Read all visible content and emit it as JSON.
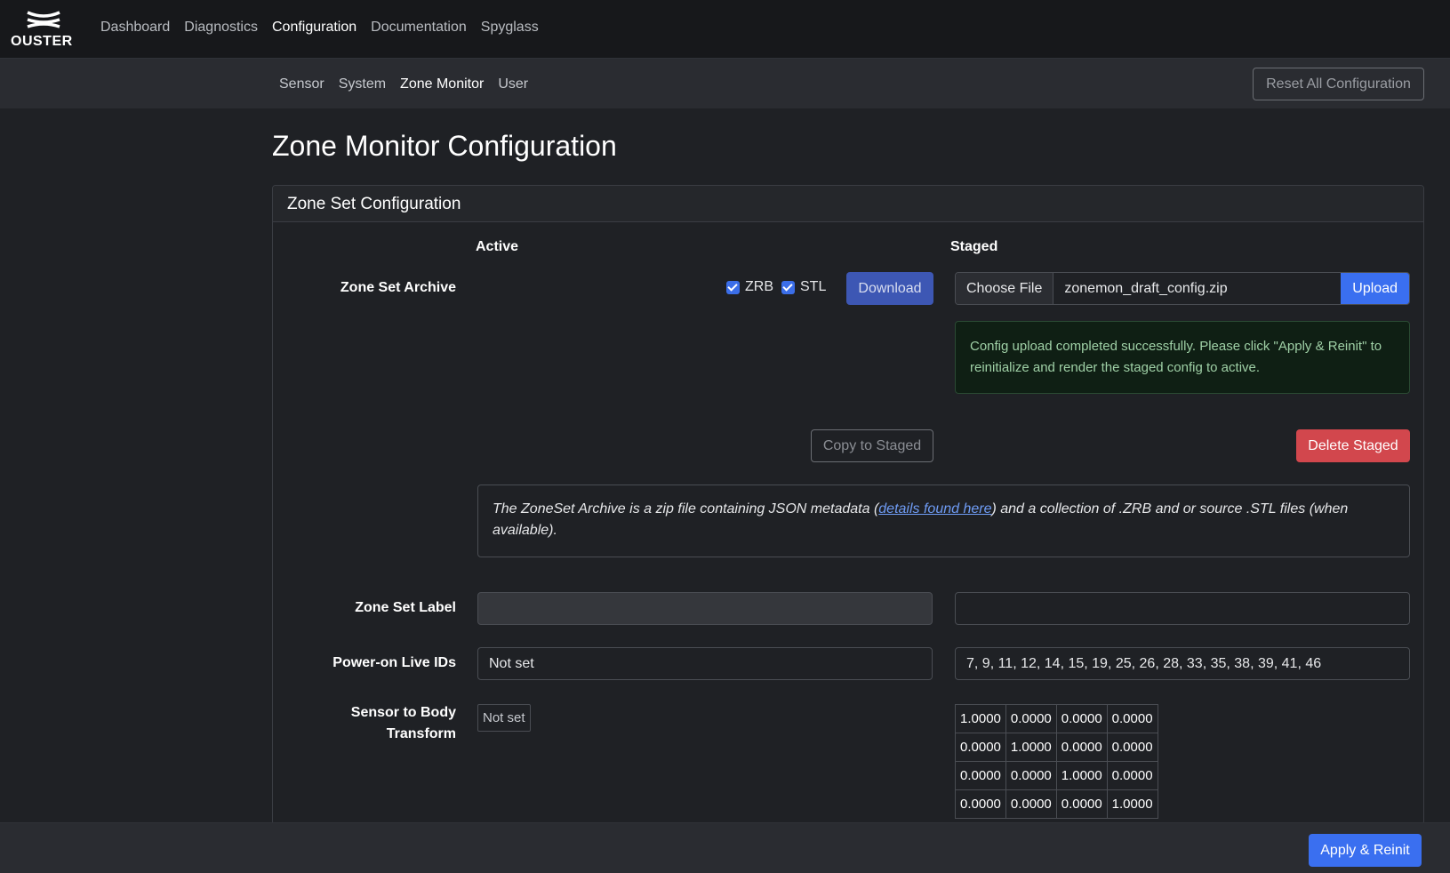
{
  "brand": {
    "name": "OUSTER"
  },
  "nav": {
    "items": [
      {
        "label": "Dashboard",
        "active": false
      },
      {
        "label": "Diagnostics",
        "active": false
      },
      {
        "label": "Configuration",
        "active": true
      },
      {
        "label": "Documentation",
        "active": false
      },
      {
        "label": "Spyglass",
        "active": false
      }
    ]
  },
  "subnav": {
    "items": [
      {
        "label": "Sensor",
        "active": false
      },
      {
        "label": "System",
        "active": false
      },
      {
        "label": "Zone Monitor",
        "active": true
      },
      {
        "label": "User",
        "active": false
      }
    ],
    "reset_label": "Reset All Configuration"
  },
  "page": {
    "title": "Zone Monitor Configuration"
  },
  "card": {
    "title": "Zone Set Configuration",
    "active_heading": "Active",
    "staged_heading": "Staged",
    "archive": {
      "label": "Zone Set Archive",
      "zrb_label": "ZRB",
      "zrb_checked": true,
      "stl_label": "STL",
      "stl_checked": true,
      "download_label": "Download",
      "choose_file_label": "Choose File",
      "file_name": "zonemon_draft_config.zip",
      "upload_label": "Upload",
      "alert_text": "Config upload completed successfully. Please click \"Apply & Reinit\" to reinitialize and render the staged config to active.",
      "copy_label": "Copy to Staged",
      "delete_label": "Delete Staged",
      "info_prefix": "The ZoneSet Archive is a zip file containing JSON metadata (",
      "info_link": "details found here",
      "info_suffix": ") and a collection of .ZRB and or source .STL files (when available)."
    },
    "label_row": {
      "label": "Zone Set Label",
      "active_value": "",
      "staged_value": ""
    },
    "live_ids": {
      "label": "Power-on Live IDs",
      "active_value": "Not set",
      "staged_value": "7, 9, 11, 12, 14, 15, 19, 25, 26, 28, 33, 35, 38, 39, 41, 46"
    },
    "transform": {
      "label_line1": "Sensor to Body",
      "label_line2": "Transform",
      "active_value": "Not set",
      "staged_matrix": [
        [
          "1.0000",
          "0.0000",
          "0.0000",
          "0.0000"
        ],
        [
          "0.0000",
          "1.0000",
          "0.0000",
          "0.0000"
        ],
        [
          "0.0000",
          "0.0000",
          "1.0000",
          "0.0000"
        ],
        [
          "0.0000",
          "0.0000",
          "0.0000",
          "1.0000"
        ]
      ]
    }
  },
  "footer": {
    "apply_label": "Apply & Reinit"
  },
  "colors": {
    "accent": "#3a6ff0",
    "danger": "#d2474d",
    "success_text": "#9fd0a6"
  }
}
